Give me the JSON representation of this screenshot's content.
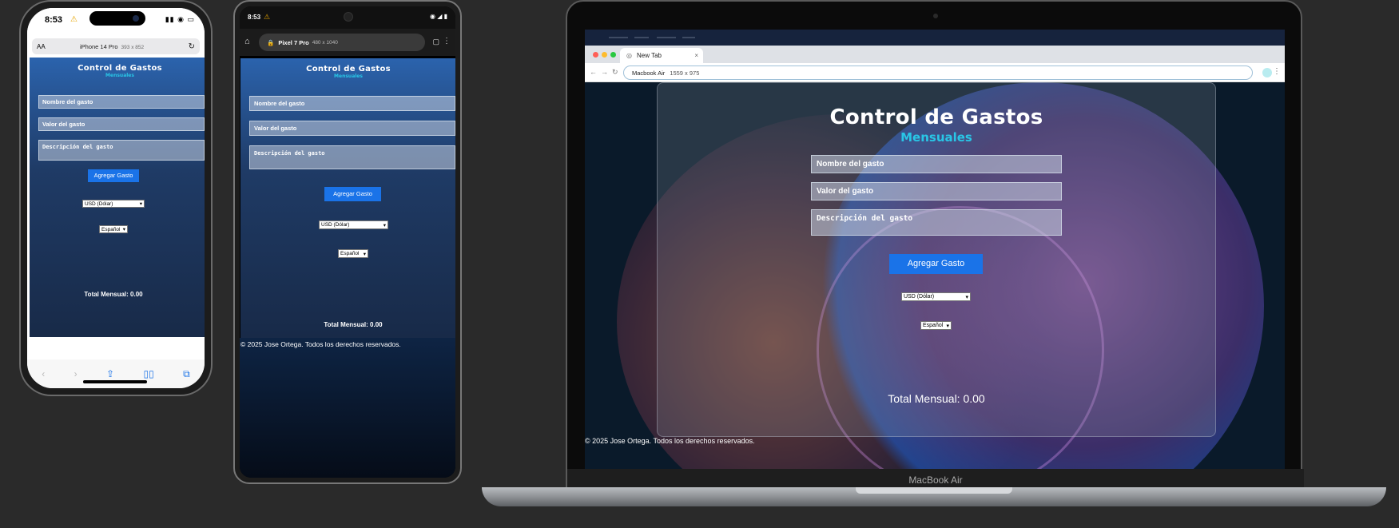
{
  "iphone": {
    "time": "8:53",
    "url_aa": "AA",
    "device_label": "iPhone 14 Pro",
    "device_size": "393 x 852"
  },
  "pixel": {
    "time": "8:53",
    "device_label": "Pixel 7 Pro",
    "device_size": "480 x 1040"
  },
  "macbook": {
    "tab_title": "New Tab",
    "device_label": "Macbook Air",
    "device_size": "1559 x 975",
    "brand_label": "MacBook Air"
  },
  "app": {
    "title": "Control de Gastos",
    "subtitle": "Mensuales",
    "name_placeholder": "Nombre del gasto",
    "value_placeholder": "Valor del gasto",
    "desc_placeholder": "Descripción del gasto",
    "add_button": "Agregar Gasto",
    "currency_selected": "USD (Dólar)",
    "language_selected": "Español",
    "total_label": "Total Mensual: 0.00",
    "footer": "© 2025 Jose Ortega. Todos los derechos reservados."
  },
  "colors": {
    "accent": "#1a73e8",
    "subtitle": "#29c6e6",
    "warning": "#e6a400"
  }
}
